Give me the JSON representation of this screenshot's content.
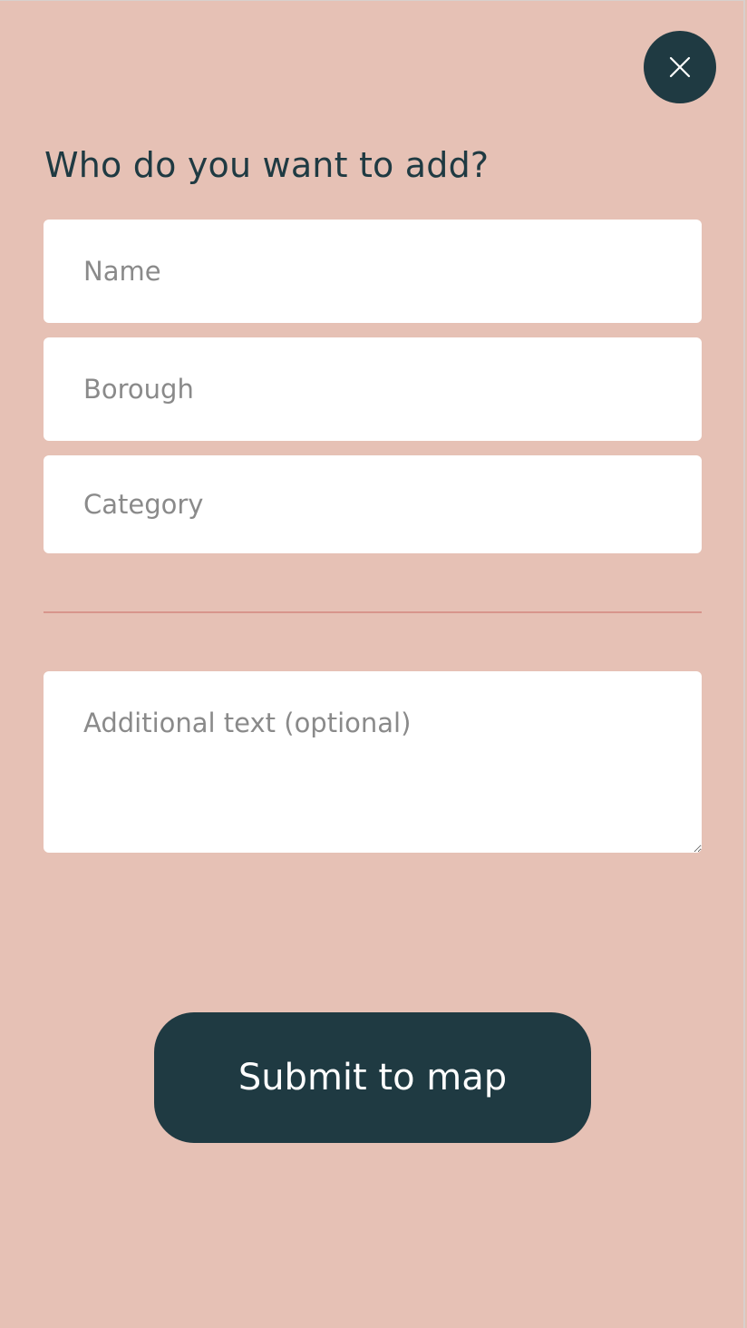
{
  "header": {
    "close_icon": "close-icon"
  },
  "form": {
    "title": "Who do you want to add?",
    "name_placeholder": "Name",
    "borough_placeholder": "Borough",
    "category_placeholder": "Category",
    "additional_placeholder": "Additional text (optional)",
    "submit_label": "Submit to map"
  },
  "colors": {
    "background": "#e6c1b5",
    "accent": "#1f3a42",
    "field_bg": "#ffffff",
    "placeholder": "#8a8a8a",
    "divider": "#d7958c"
  }
}
